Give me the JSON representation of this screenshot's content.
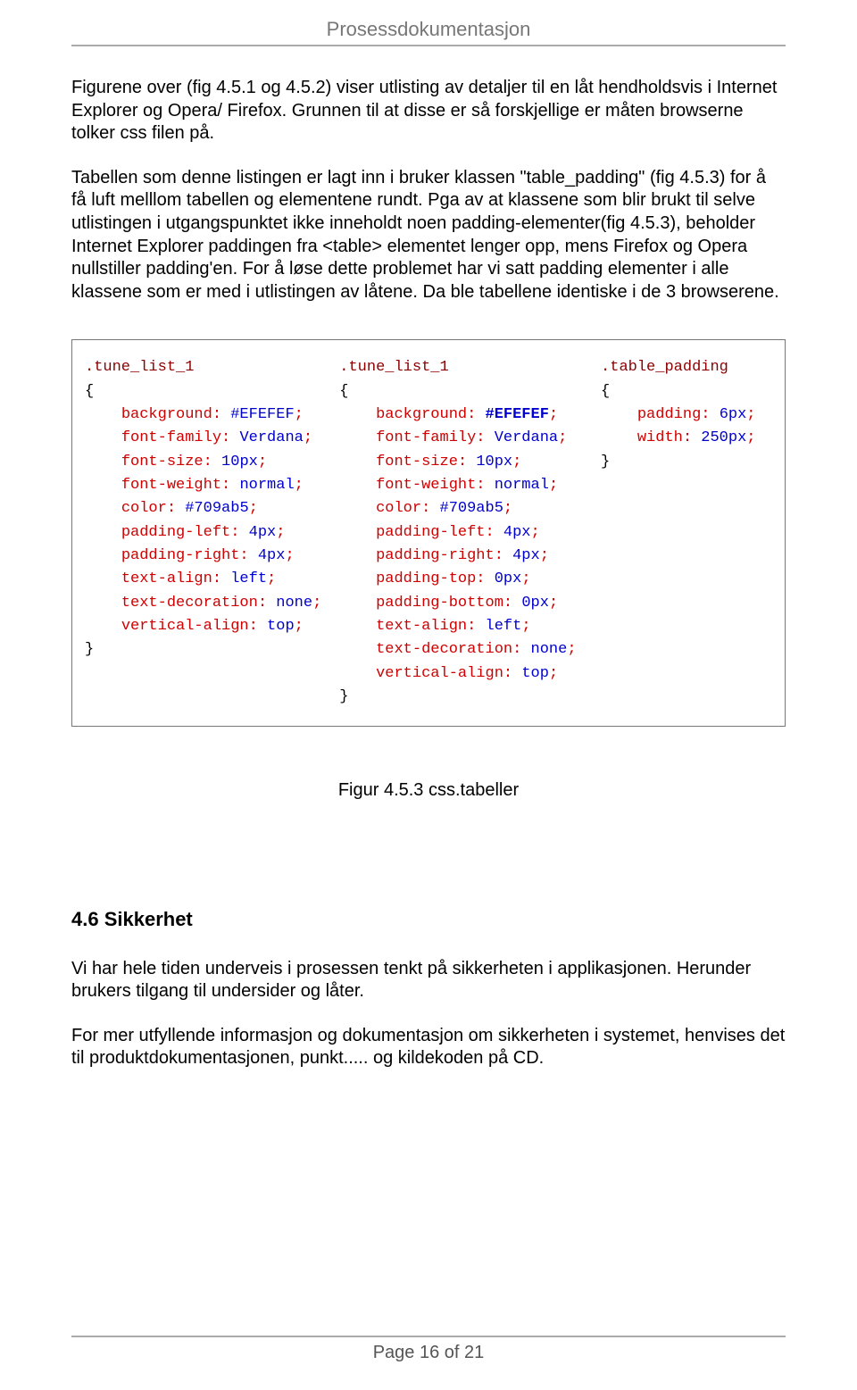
{
  "header": {
    "title": "Prosessdokumentasjon"
  },
  "paragraphs": {
    "p1": "Figurene over (fig 4.5.1 og 4.5.2) viser utlisting av detaljer til en låt hendholdsvis i Internet Explorer og Opera/ Firefox. Grunnen til at disse er så forskjellige er måten browserne tolker css filen på.",
    "p2": "Tabellen som denne listingen er lagt inn i bruker klassen \"table_padding\" (fig 4.5.3) for å få luft melllom tabellen og elementene rundt. Pga av at klassene som blir brukt til selve utlistingen i utgangspunktet ikke inneholdt noen padding-elementer(fig 4.5.3), beholder Internet Explorer paddingen fra <table> elementet lenger opp, mens Firefox og Opera nullstiller padding'en. For å løse dette problemet har vi satt padding elementer i alle klassene som er med i utlistingen av låtene. Da ble tabellene identiske i de 3 browserene."
  },
  "code": {
    "col1": {
      "selector": ".tune_list_1",
      "decls": [
        [
          "background",
          "#EFEFEF"
        ],
        [
          "font-family",
          "Verdana"
        ],
        [
          "font-size",
          "10px"
        ],
        [
          "font-weight",
          "normal"
        ],
        [
          "color",
          "#709ab5"
        ],
        [
          "padding-left",
          "4px"
        ],
        [
          "padding-right",
          "4px"
        ],
        [
          "text-align",
          "left"
        ],
        [
          "text-decoration",
          "none"
        ],
        [
          "vertical-align",
          "top"
        ]
      ]
    },
    "col2": {
      "selector": ".tune_list_1",
      "decls": [
        [
          "background",
          "#EFEFEF"
        ],
        [
          "font-family",
          "Verdana"
        ],
        [
          "font-size",
          "10px"
        ],
        [
          "font-weight",
          "normal"
        ],
        [
          "color",
          "#709ab5"
        ],
        [
          "padding-left",
          "4px"
        ],
        [
          "padding-right",
          "4px"
        ],
        [
          "padding-top",
          "0px"
        ],
        [
          "padding-bottom",
          "0px"
        ],
        [
          "text-align",
          "left"
        ],
        [
          "text-decoration",
          "none"
        ],
        [
          "vertical-align",
          "top"
        ]
      ]
    },
    "col3": {
      "selector": ".table_padding",
      "decls": [
        [
          "padding",
          "6px"
        ],
        [
          "width",
          "250px"
        ]
      ]
    }
  },
  "figure_caption": "Figur 4.5.3 css.tabeller",
  "section": {
    "heading": "4.6 Sikkerhet",
    "p1": "Vi har hele tiden underveis i prosessen tenkt på sikkerheten i applikasjonen. Herunder brukers tilgang til undersider og låter.",
    "p2": "For mer utfyllende informasjon og dokumentasjon om sikkerheten i systemet, henvises det til produktdokumentasjonen, punkt..... og kildekoden på CD."
  },
  "footer": {
    "text": "Page 16 of 21"
  }
}
